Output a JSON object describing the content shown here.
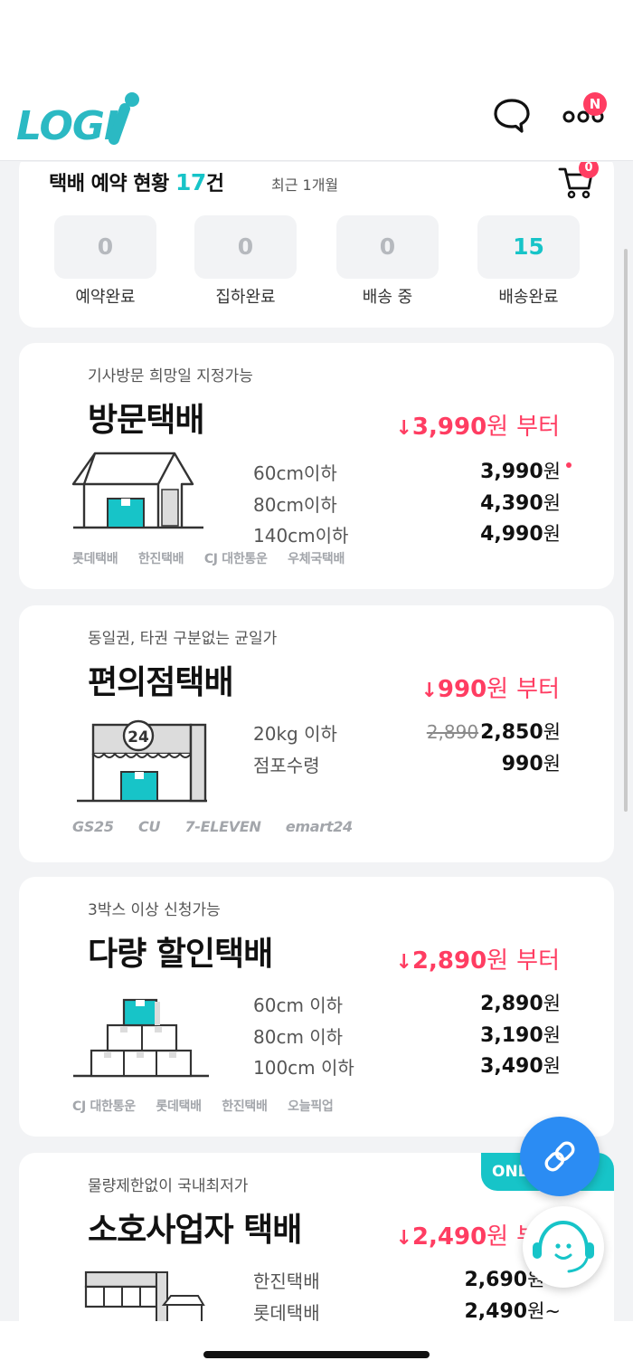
{
  "header": {
    "logo_text": "LOGIi",
    "menu_badge": "N",
    "icons": [
      "chat-bubble-icon",
      "more-menu-icon"
    ]
  },
  "reservation": {
    "title": "택배 예약 현황",
    "count": "17",
    "unit": "건",
    "period": "최근 1개월",
    "cart_badge": "0",
    "stats": [
      {
        "value": "0",
        "label": "예약완료"
      },
      {
        "value": "0",
        "label": "집하완료"
      },
      {
        "value": "0",
        "label": "배송 중"
      },
      {
        "value": "15",
        "label": "배송완료"
      }
    ]
  },
  "services": [
    {
      "subtitle": "기사방문 희망일 지정가능",
      "title": "방문택배",
      "price": "3,990",
      "won": "원",
      "suffix": "부터",
      "rows": [
        {
          "label": "60cm이하",
          "value": "3,990",
          "won": "원"
        },
        {
          "label": "80cm이하",
          "value": "4,390",
          "won": "원"
        },
        {
          "label": "140cm이하",
          "value": "4,990",
          "won": "원"
        }
      ],
      "brands": [
        "롯데택배",
        "한진택배",
        "CJ 대한통운",
        "우체국택배"
      ]
    },
    {
      "subtitle": "동일권, 타권 구분없는 균일가",
      "title": "편의점택배",
      "price": "990",
      "won": "원",
      "suffix": "부터",
      "rows": [
        {
          "label": "20kg 이하",
          "old_value": "2,890",
          "value": "2,850",
          "won": "원"
        },
        {
          "label": "점포수령",
          "value": "990",
          "won": "원"
        }
      ],
      "brands": [
        "GS25",
        "CU",
        "7-ELEVEN",
        "emart24"
      ],
      "illustration_text": "24"
    },
    {
      "subtitle": "3박스 이상 신청가능",
      "title": "다량 할인택배",
      "price": "2,890",
      "won": "원",
      "suffix": "부터",
      "rows": [
        {
          "label": "60cm 이하",
          "value": "2,890",
          "won": "원"
        },
        {
          "label": "80cm 이하",
          "value": "3,190",
          "won": "원"
        },
        {
          "label": "100cm 이하",
          "value": "3,490",
          "won": "원"
        }
      ],
      "brands": [
        "CJ 대한통운",
        "롯데택배",
        "한진택배",
        "오늘픽업"
      ]
    },
    {
      "subtitle": "물량제한없이 국내최저가",
      "title": "소호사업자 택배",
      "price": "2,490",
      "won": "원",
      "suffix": "부터",
      "tag": "ONLINE",
      "rows": [
        {
          "label": "한진택배",
          "value": "2,690",
          "won": "원~"
        },
        {
          "label": "롯데택배",
          "value": "2,490",
          "won": "원~"
        }
      ]
    }
  ],
  "colors": {
    "accent": "#17c4c8",
    "price": "#ff3d62",
    "fab": "#2b8cf3",
    "background": "#f2f3f5"
  }
}
